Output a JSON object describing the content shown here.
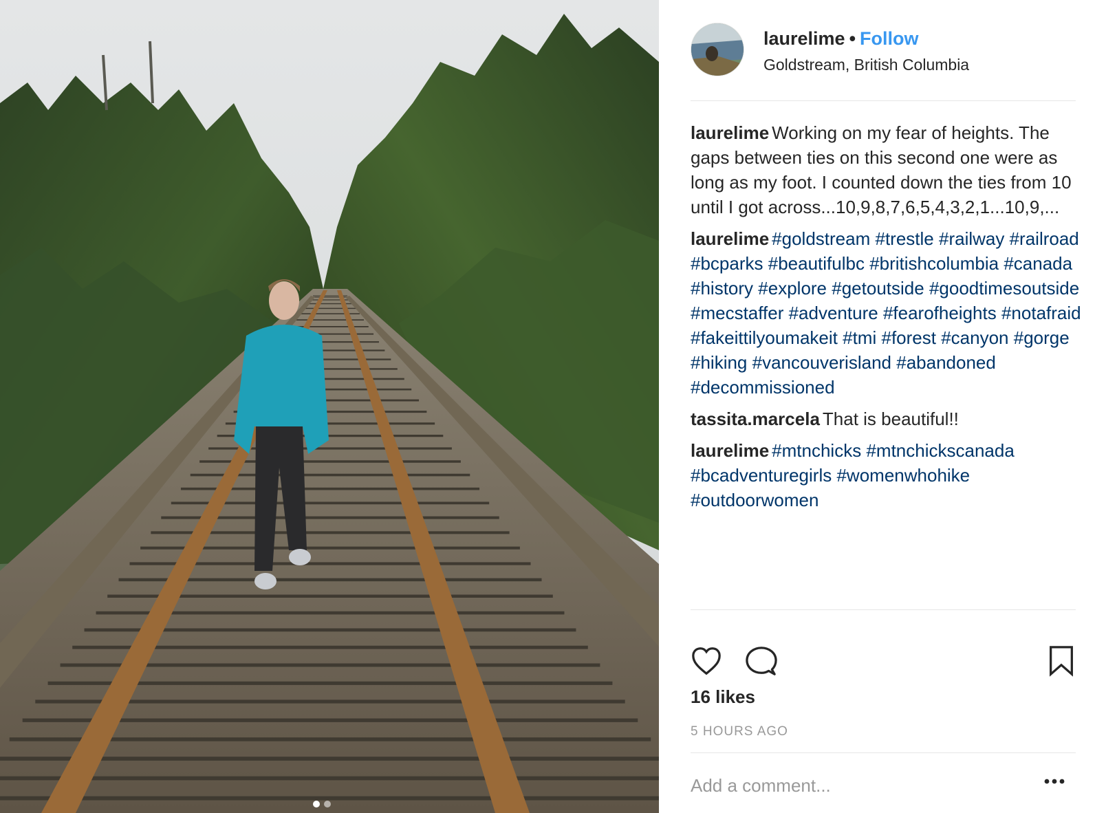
{
  "post": {
    "username": "laurelime",
    "separator": "•",
    "follow_label": "Follow",
    "location": "Goldstream, British Columbia",
    "comments": [
      {
        "user": "laurelime",
        "text": "Working on my fear of heights. The gaps between ties on this second one were as long as my foot. I counted down the ties from 10 until I got across...10,9,8,7,6,5,4,3,2,1...10,9,...",
        "tags": []
      },
      {
        "user": "laurelime",
        "text": "",
        "tags": [
          "#goldstream",
          "#trestle",
          "#railway",
          "#railroad",
          "#bcparks",
          "#beautifulbc",
          "#britishcolumbia",
          "#canada",
          "#history",
          "#explore",
          "#getoutside",
          "#goodtimesoutside",
          "#mecstaffer",
          "#adventure",
          "#fearofheights",
          "#notafraid",
          "#fakeittilyoumakeit",
          "#tmi",
          "#forest",
          "#canyon",
          "#gorge",
          "#hiking",
          "#vancouverisland",
          "#abandoned",
          "#decommissioned"
        ]
      },
      {
        "user": "tassita.marcela",
        "text": "That is beautiful!!",
        "tags": []
      },
      {
        "user": "laurelime",
        "text": "",
        "tags": [
          "#mtnchicks",
          "#mtnchickscanada",
          "#bcadventuregirls",
          "#womenwhohike",
          "#outdoorwomen"
        ]
      }
    ],
    "likes_text": "16 likes",
    "time_text": "5 HOURS AGO",
    "add_comment_placeholder": "Add a comment...",
    "more_label": "•••"
  },
  "carousel": {
    "slide_count": 2,
    "active_index": 0
  },
  "icons": {
    "like": "heart-icon",
    "comment": "comment-bubble-icon",
    "save": "bookmark-icon",
    "more": "more-options-icon"
  },
  "colors": {
    "follow": "#3897f0",
    "hashtag": "#003569",
    "muted": "#999999",
    "text": "#262626",
    "divider": "#e6e6e6"
  }
}
